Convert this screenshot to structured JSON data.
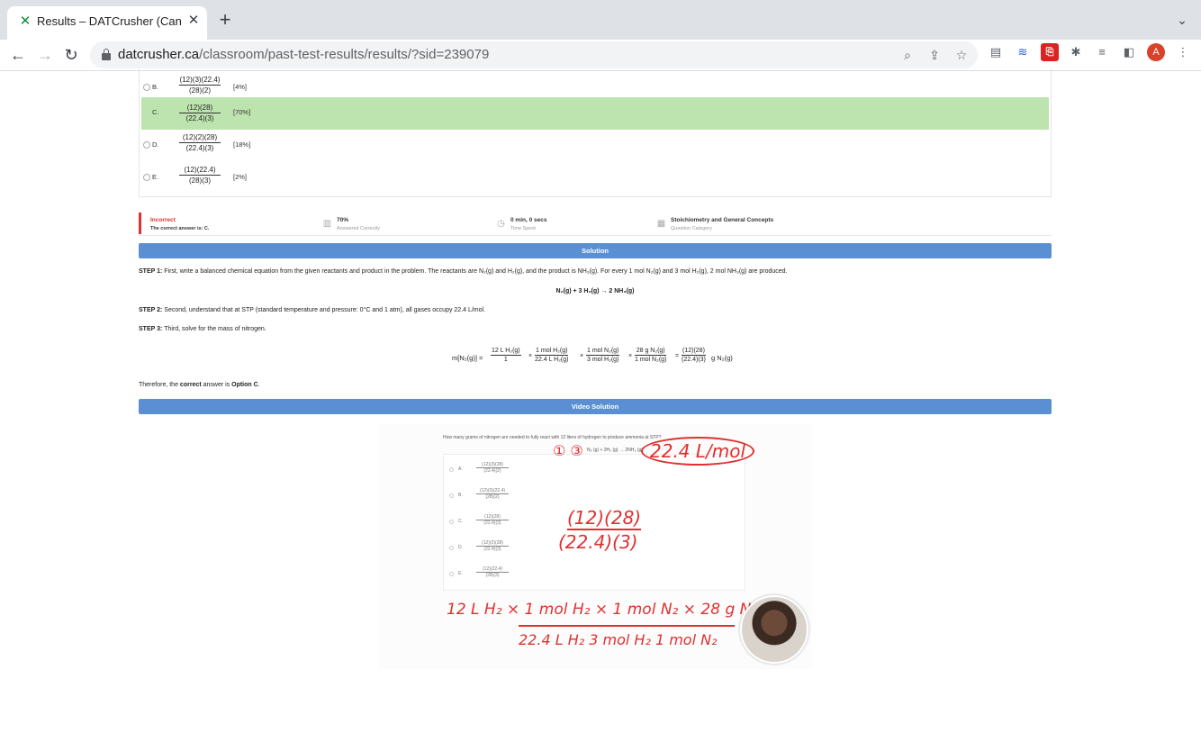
{
  "browser": {
    "tab_title": "Results – DATCrusher (Canadia",
    "url_host": "datcrusher.ca",
    "url_path": "/classroom/past-test-results/results/?sid=239079",
    "avatar_letter": "A"
  },
  "answers": [
    {
      "letter": "B.",
      "num": "(12)(3)(22.4)",
      "den": "(28)(2)",
      "pct": "[4%]"
    },
    {
      "letter": "C.",
      "num": "(12)(28)",
      "den": "(22.4)(3)",
      "pct": "[70%]"
    },
    {
      "letter": "D.",
      "num": "(12)(2)(28)",
      "den": "(22.4)(3)",
      "pct": "[18%]"
    },
    {
      "letter": "E.",
      "num": "(12)(22.4)",
      "den": "(28)(3)",
      "pct": "[2%]"
    }
  ],
  "stats": {
    "result_title": "Incorrect",
    "result_sub": "The correct answer is: C.",
    "percent_title": "70%",
    "percent_sub": "Answered Correctly",
    "time_title": "0 min, 0 secs",
    "time_sub": "Time Spent",
    "category_title": "Stoichiometry and General Concepts",
    "category_sub": "Question Category"
  },
  "solution": {
    "header": "Solution",
    "step1_label": "STEP 1:",
    "step1_text": " First, write a balanced chemical equation from the given reactants and product in the problem. The reactants are N₂(g) and H₂(g), and the product is NH₃(g). For every 1 mol N₂(g) and 3 mol H₂(g), 2 mol NH₃(g) are produced.",
    "equation": "N₂(g) + 3 H₂(g) → 2 NH₃(g)",
    "step2_label": "STEP 2:",
    "step2_text": " Second, understand that at STP (standard temperature and pressure: 0°C and 1 atm), all gases occupy 22.4 L/mol.",
    "step3_label": "STEP 3:",
    "step3_text": " Third, solve for the mass of nitrogen.",
    "calc_lhs": "m[N₂(g)] =",
    "calc_fracs": [
      {
        "num": "12 L H₂(g)",
        "den": "1"
      },
      {
        "num": "1 mol H₂(g)",
        "den": "22.4 L H₂(g)"
      },
      {
        "num": "1 mol N₂(g)",
        "den": "3 mol H₂(g)"
      },
      {
        "num": "28 g N₂(g)",
        "den": "1 mol N₂(g)"
      },
      {
        "num": "(12)(28)",
        "den": "(22.4)(3)"
      }
    ],
    "calc_tail": "g N₂(g)",
    "conclusion_pre": "Therefore, the ",
    "conclusion_bold": "correct",
    "conclusion_mid": " answer is ",
    "conclusion_answer": "Option C",
    "conclusion_end": "."
  },
  "video": {
    "header": "Video Solution",
    "question": "How many grams of nitrogen are needed to fully react with 12 liters of hydrogen to produce ammonia at STP?",
    "equation": "N₂ (g) + 3H₂ (g) → 2NH₃ (g)",
    "options": [
      {
        "letter": "A.",
        "num": "(12)(3)(28)",
        "den": "(22.4)(2)"
      },
      {
        "letter": "B.",
        "num": "(12)(3)(22.4)",
        "den": "(28)(2)"
      },
      {
        "letter": "C.",
        "num": "(12)(28)",
        "den": "(22.4)(3)"
      },
      {
        "letter": "D.",
        "num": "(12)(2)(28)",
        "den": "(22.4)(3)"
      },
      {
        "letter": "E.",
        "num": "(12)(22.4)",
        "den": "(28)(3)"
      }
    ],
    "ink_coefs": "① ③",
    "ink_molar": "22.4 L/mol",
    "ink_ans_num": "(12)(28)",
    "ink_ans_den": "(22.4)(3)",
    "ink_calc_top": "12 L H₂  ×  1 mol H₂  ×  1 mol N₂  ×  28 g N₂",
    "ink_calc_bottom": "22.4 L H₂     3 mol H₂     1 mol N₂"
  }
}
